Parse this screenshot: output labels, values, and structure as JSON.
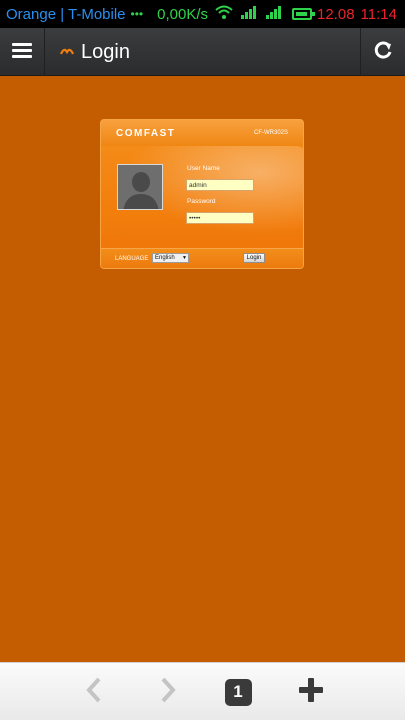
{
  "status_bar": {
    "carrier": "Orange | T-Mobile",
    "dots": "•••",
    "speed": "0,00K/s",
    "date": "12.08",
    "time": "11:14",
    "icons": [
      "wifi-icon",
      "signal-icon",
      "signal-icon",
      "battery-icon"
    ]
  },
  "toolbar": {
    "title": "Login",
    "menu_icon": "hamburger-icon",
    "site_icon": "site-icon",
    "reload_icon": "reload-icon"
  },
  "login_card": {
    "brand": "COMFAST",
    "model": "CF-WR302S",
    "user_label": "User Name",
    "user_value": "admin",
    "password_label": "Password",
    "password_value": "•••••",
    "language_label": "LANGUAGE",
    "language_selected": "English",
    "login_button": "Login"
  },
  "bottom_bar": {
    "tab_count": "1",
    "icons": [
      "back-icon",
      "forward-icon",
      "tabs-icon",
      "new-tab-icon"
    ]
  },
  "colors": {
    "page_background": "#c45c02",
    "card_orange": "#f27f0d",
    "status_green": "#2fd24b",
    "status_blue": "#2a8ff0",
    "status_red": "#e8242a"
  }
}
